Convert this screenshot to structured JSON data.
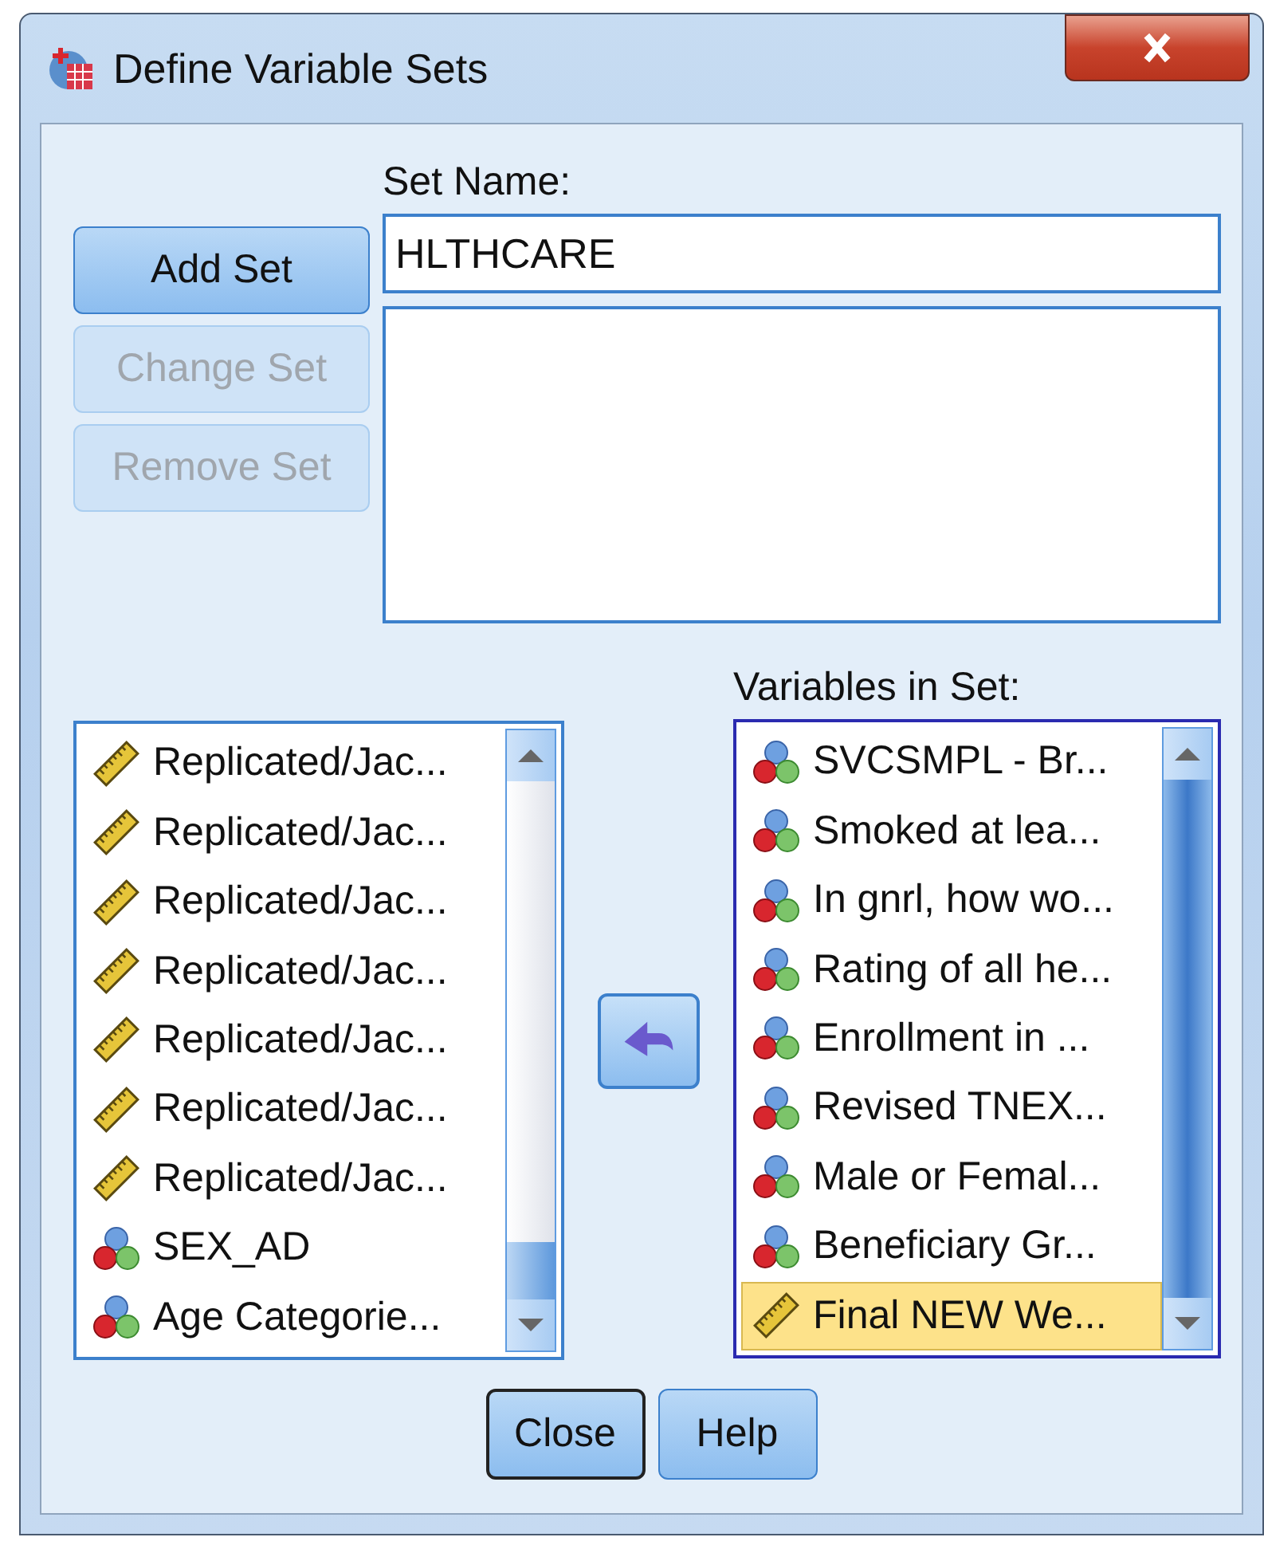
{
  "window": {
    "title": "Define Variable Sets"
  },
  "set_buttons": [
    {
      "label": "Add Set",
      "disabled": false
    },
    {
      "label": "Change Set",
      "disabled": true
    },
    {
      "label": "Remove Set",
      "disabled": true
    }
  ],
  "set_name": {
    "label": "Set Name:",
    "value": "HLTHCARE"
  },
  "source_list": {
    "items": [
      {
        "kind": "scale",
        "label": "Replicated/Jac...",
        "selected": false
      },
      {
        "kind": "scale",
        "label": "Replicated/Jac...",
        "selected": false
      },
      {
        "kind": "scale",
        "label": "Replicated/Jac...",
        "selected": false
      },
      {
        "kind": "scale",
        "label": "Replicated/Jac...",
        "selected": false
      },
      {
        "kind": "scale",
        "label": "Replicated/Jac...",
        "selected": false
      },
      {
        "kind": "scale",
        "label": "Replicated/Jac...",
        "selected": false
      },
      {
        "kind": "scale",
        "label": "Replicated/Jac...",
        "selected": false
      },
      {
        "kind": "nominal",
        "label": "SEX_AD",
        "selected": false
      },
      {
        "kind": "nominal",
        "label": "Age Categorie...",
        "selected": false
      }
    ]
  },
  "set_variables": {
    "label": "Variables in Set:",
    "items": [
      {
        "kind": "nominal",
        "label": "SVCSMPL - Br...",
        "selected": false
      },
      {
        "kind": "nominal",
        "label": "Smoked at lea...",
        "selected": false
      },
      {
        "kind": "nominal",
        "label": "In gnrl, how wo...",
        "selected": false
      },
      {
        "kind": "nominal",
        "label": "Rating of all he...",
        "selected": false
      },
      {
        "kind": "nominal",
        "label": "Enrollment in ...",
        "selected": false
      },
      {
        "kind": "nominal",
        "label": "Revised TNEX...",
        "selected": false
      },
      {
        "kind": "nominal",
        "label": "Male or Femal...",
        "selected": false
      },
      {
        "kind": "nominal",
        "label": "Beneficiary Gr...",
        "selected": false
      },
      {
        "kind": "scale",
        "label": "Final NEW We...",
        "selected": true
      }
    ]
  },
  "footer_buttons": [
    {
      "label": "Close",
      "default": true
    },
    {
      "label": "Help",
      "default": false
    }
  ]
}
